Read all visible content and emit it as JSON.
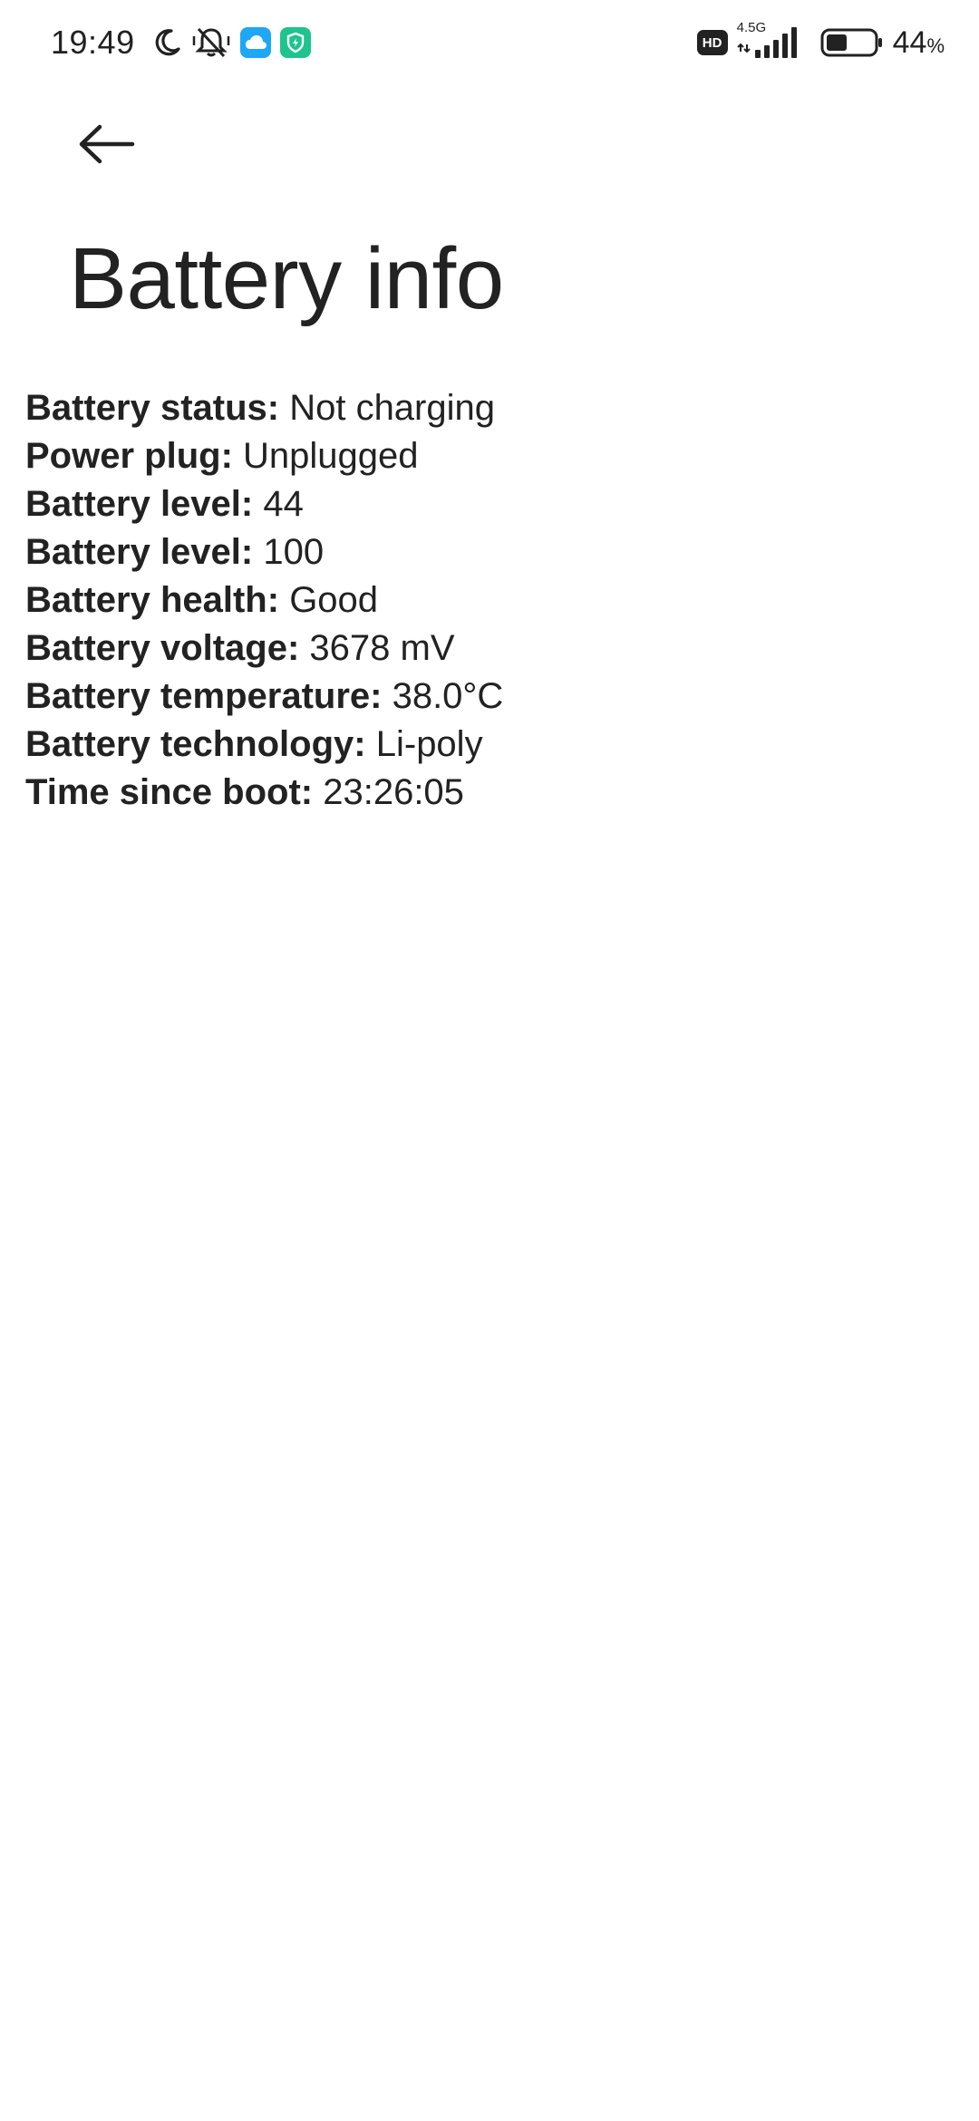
{
  "status_bar": {
    "time": "19:49",
    "network_type": "4.5G",
    "hd_badge": "HD",
    "battery_percent": "44",
    "battery_percent_sign": "%",
    "battery_level_fraction": 0.44,
    "icons": [
      "moon-icon",
      "mute-bell-icon",
      "cloud-app-icon",
      "security-app-icon",
      "hd-icon",
      "signal-icon",
      "battery-icon"
    ],
    "colors": {
      "cloud_app": "#1EA7F4",
      "security_app": "#1FC38E"
    }
  },
  "header": {
    "back_icon": "arrow-left-icon",
    "title": "Battery info"
  },
  "info": {
    "separator": ": ",
    "rows": [
      {
        "label": "Battery status",
        "value": "Not charging"
      },
      {
        "label": "Power plug",
        "value": "Unplugged"
      },
      {
        "label": "Battery level",
        "value": "44"
      },
      {
        "label": "Battery level",
        "value": "100"
      },
      {
        "label": "Battery health",
        "value": "Good"
      },
      {
        "label": "Battery voltage",
        "value": "3678 mV"
      },
      {
        "label": "Battery temperature",
        "value": "38.0°C"
      },
      {
        "label": "Battery technology",
        "value": "Li-poly"
      },
      {
        "label": "Time since boot",
        "value": "23:26:05"
      }
    ]
  }
}
